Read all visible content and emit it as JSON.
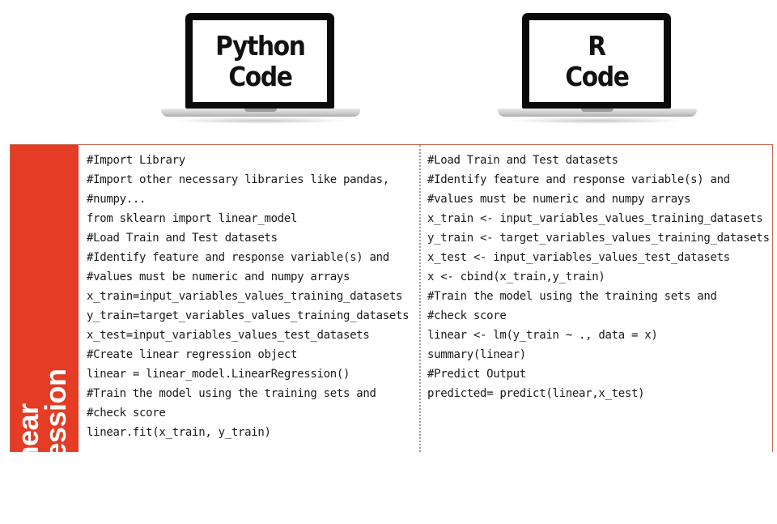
{
  "laptops": [
    {
      "line1": "Python",
      "line2": "Code"
    },
    {
      "line1": "R",
      "line2": "Code"
    }
  ],
  "side_label": {
    "line1": "Linear",
    "line2": "Regression"
  },
  "colors": {
    "accent": "#e43c25",
    "panel_border": "#c86a55"
  },
  "python_code": [
    "#Import Library",
    "#Import other necessary libraries like pandas,",
    "#numpy...",
    "from sklearn import linear_model",
    "#Load Train and Test datasets",
    "#Identify feature and response variable(s) and",
    "#values must be numeric and numpy arrays",
    "x_train=input_variables_values_training_datasets",
    "y_train=target_variables_values_training_datasets",
    "x_test=input_variables_values_test_datasets",
    "#Create linear regression object",
    "linear = linear_model.LinearRegression()",
    "#Train the model using the training sets and",
    "#check score",
    "linear.fit(x_train, y_train)"
  ],
  "r_code": [
    "#Load Train and Test datasets",
    "#Identify feature and response variable(s) and",
    "#values must be numeric and numpy arrays",
    "x_train <- input_variables_values_training_datasets",
    "y_train <- target_variables_values_training_datasets",
    "x_test <- input_variables_values_test_datasets",
    "x <- cbind(x_train,y_train)",
    "#Train the model using the training sets and",
    "#check score",
    "linear <- lm(y_train ~ ., data = x)",
    "summary(linear)",
    "#Predict Output",
    "predicted= predict(linear,x_test)"
  ]
}
